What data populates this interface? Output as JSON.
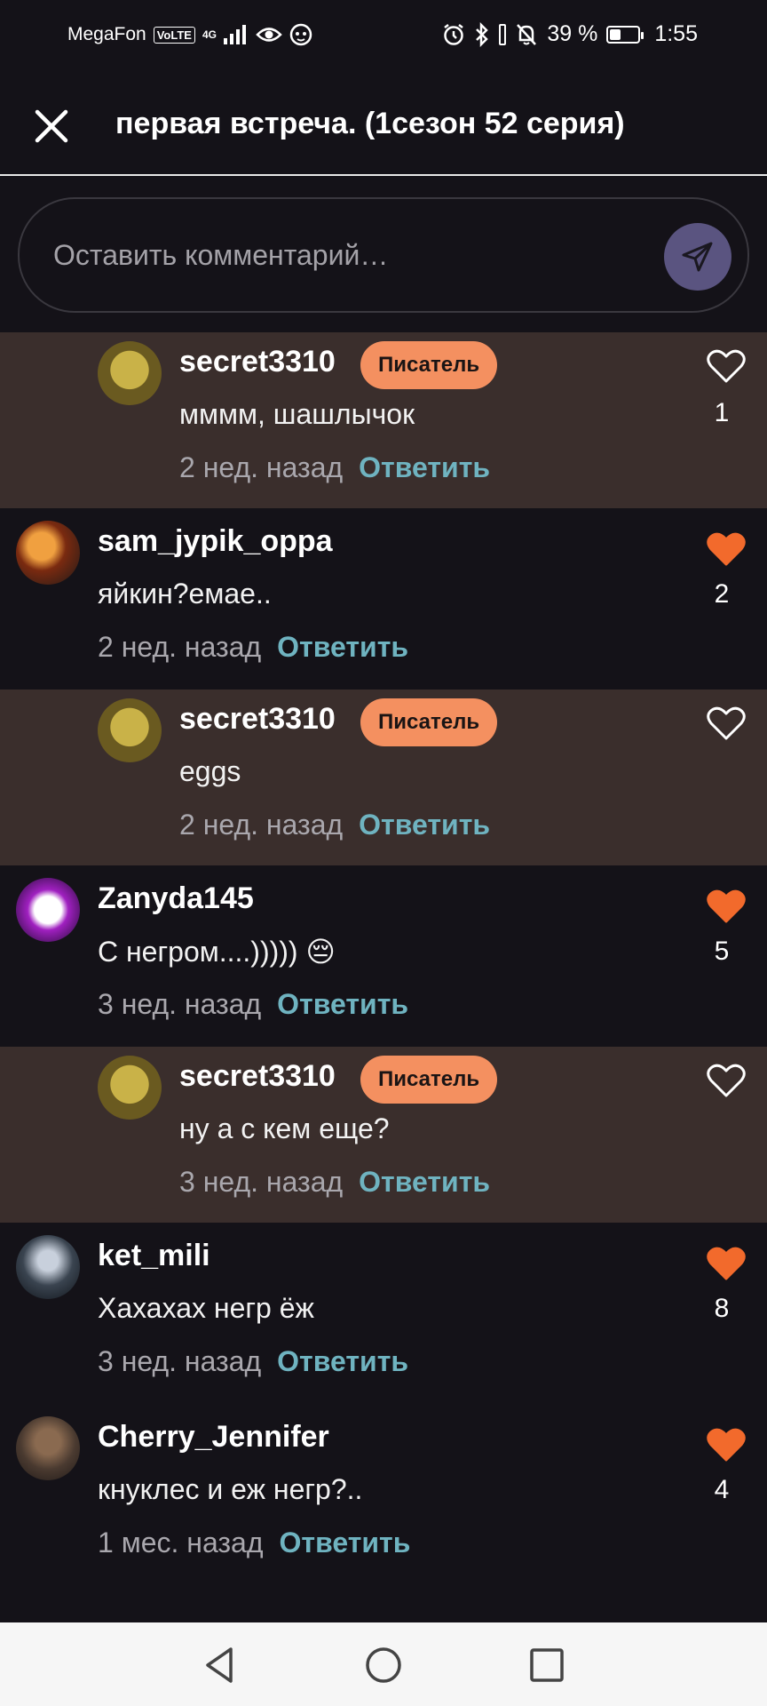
{
  "status_bar": {
    "carrier": "MegaFon",
    "volte": "VoLTE",
    "network": "4G",
    "battery": "39 %",
    "battery_level": 0.39,
    "time": "1:55"
  },
  "header": {
    "title": "первая встреча. (1сезон 52 серия)"
  },
  "comment_input": {
    "placeholder": "Оставить комментарий…"
  },
  "reply_label": "Ответить",
  "badge_label": "Писатель",
  "comments": [
    {
      "type": "reply",
      "username": "secret3310",
      "badge": true,
      "text": "мммм, шашлычок",
      "time": "2 нед. назад",
      "liked": false,
      "likes": "1"
    },
    {
      "type": "top",
      "username": "sam_jypik_oppa",
      "badge": false,
      "text": "яйкин?емае..",
      "time": "2 нед. назад",
      "liked": true,
      "likes": "2"
    },
    {
      "type": "reply",
      "username": "secret3310",
      "badge": true,
      "text": "eggs",
      "time": "2 нед. назад",
      "liked": false,
      "likes": ""
    },
    {
      "type": "top",
      "username": "Zanyda145",
      "badge": false,
      "text": "С негром....))))) 😔",
      "time": "3 нед. назад",
      "liked": true,
      "likes": "5"
    },
    {
      "type": "reply",
      "username": "secret3310",
      "badge": true,
      "text": "ну а с кем еще?",
      "time": "3 нед. назад",
      "liked": false,
      "likes": ""
    },
    {
      "type": "top",
      "username": "ket_mili",
      "badge": false,
      "text": "Хахахах негр ёж",
      "time": "3 нед. назад",
      "liked": true,
      "likes": "8"
    },
    {
      "type": "top",
      "username": "Cherry_Jennifer",
      "badge": false,
      "text": "кнуклес и еж негр?..",
      "time": "1 мес. назад",
      "liked": true,
      "likes": "4"
    }
  ],
  "colors": {
    "background": "#141218",
    "reply_background": "#3a2e2c",
    "badge": "#f49060",
    "like_active": "#f26a2c",
    "reply_link": "#6fb3c0",
    "send_button": "#5a5480"
  },
  "icons": {
    "close": "close-icon",
    "send": "send-icon",
    "like": "heart-icon",
    "nav_back": "back-triangle-icon",
    "nav_home": "home-circle-icon",
    "nav_recents": "recents-square-icon"
  }
}
